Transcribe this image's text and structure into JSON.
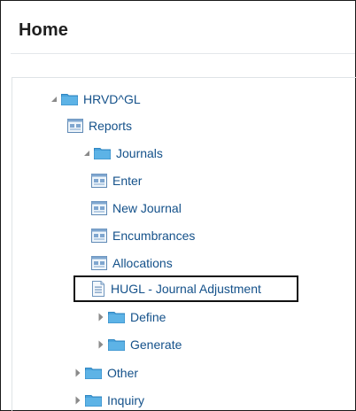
{
  "page": {
    "title": "Home"
  },
  "tree": {
    "root": {
      "label": "HRVD^GL",
      "icon": "folder-icon",
      "state": "expanded"
    },
    "reports": {
      "label": "Reports",
      "icon": "report-icon"
    },
    "journals": {
      "label": "Journals",
      "icon": "folder-icon",
      "state": "expanded",
      "items": [
        {
          "label": "Enter",
          "icon": "form-icon"
        },
        {
          "label": "New Journal",
          "icon": "form-icon"
        },
        {
          "label": "Encumbrances",
          "icon": "form-icon"
        },
        {
          "label": "Allocations",
          "icon": "form-icon"
        },
        {
          "label": "HUGL - Journal Adjustment",
          "icon": "document-icon",
          "highlighted": true
        }
      ],
      "subfolders": [
        {
          "label": "Define",
          "icon": "folder-icon",
          "state": "collapsed"
        },
        {
          "label": "Generate",
          "icon": "folder-icon",
          "state": "collapsed"
        }
      ]
    },
    "other": {
      "label": "Other",
      "icon": "folder-icon",
      "state": "collapsed"
    },
    "inquiry": {
      "label": "Inquiry",
      "icon": "folder-icon",
      "state": "collapsed"
    }
  },
  "colors": {
    "link": "#14518a",
    "folder": "#4aa3dc",
    "highlight_border": "#111111"
  }
}
